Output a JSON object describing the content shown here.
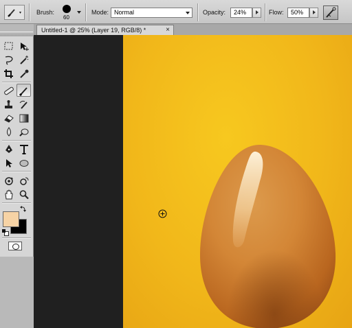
{
  "options": {
    "brush_label": "Brush:",
    "brush_size": "60",
    "mode_label": "Mode:",
    "mode_value": "Normal",
    "opacity_label": "Opacity:",
    "opacity_value": "24%",
    "flow_label": "Flow:",
    "flow_value": "50%"
  },
  "document": {
    "tab_title": "Untitled-1 @ 25% (Layer 19, RGB/8) *",
    "close_glyph": "×"
  },
  "colors": {
    "foreground": "#f6d3a5",
    "background": "#000000",
    "canvas": "#f1b71a"
  },
  "tools": [
    "marquee-tool-icon",
    "move-tool-icon",
    "lasso-tool-icon",
    "magic-wand-icon",
    "crop-tool-icon",
    "eyedropper-icon",
    "healing-brush-icon",
    "brush-tool-icon",
    "clone-stamp-icon",
    "history-brush-icon",
    "eraser-icon",
    "gradient-tool-icon",
    "blur-tool-icon",
    "dodge-tool-icon",
    "pen-tool-icon",
    "type-tool-icon",
    "path-selection-icon",
    "shape-tool-icon",
    "3d-rotate-icon",
    "3d-orbit-icon",
    "hand-tool-icon",
    "zoom-tool-icon"
  ],
  "active_tool": "brush-tool-icon"
}
